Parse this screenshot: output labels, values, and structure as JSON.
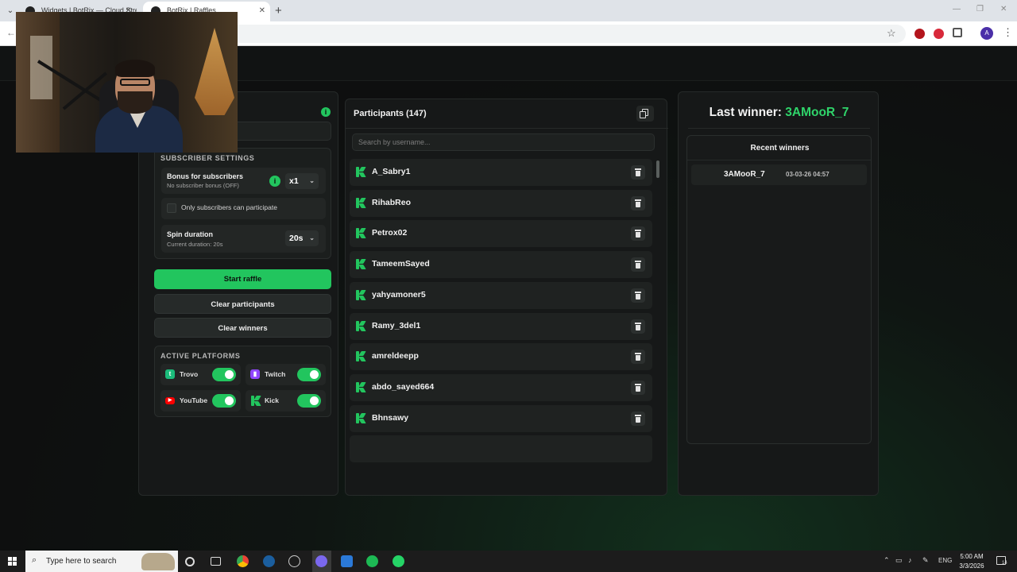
{
  "browser": {
    "tabs": [
      {
        "title": "Widgets | BotRix — Cloud Stre",
        "active": false
      },
      {
        "title": "BotRix | Raffles",
        "active": true
      }
    ],
    "profile_initial": "A"
  },
  "raffle": {
    "subscriber_settings": {
      "title": "SUBSCRIBER SETTINGS",
      "bonus_title": "Bonus for subscribers",
      "bonus_sub": "No subscriber bonus (OFF)",
      "bonus_value": "x1",
      "only_subs_label": "Only subscribers can participate",
      "only_subs_checked": false,
      "spin_title": "Spin duration",
      "spin_sub": "Current duration: 20s",
      "spin_value": "20s"
    },
    "buttons": {
      "start": "Start raffle",
      "clear_participants": "Clear participants",
      "clear_winners": "Clear winners"
    },
    "platforms": {
      "title": "ACTIVE PLATFORMS",
      "items": [
        {
          "name": "Trovo",
          "enabled": true,
          "color": "#1bbc7b"
        },
        {
          "name": "Twitch",
          "enabled": true,
          "color": "#9146ff"
        },
        {
          "name": "YouTube",
          "enabled": true,
          "color": "#ff0000"
        },
        {
          "name": "Kick",
          "enabled": true,
          "color": "#22c55e"
        }
      ]
    }
  },
  "participants": {
    "title": "Participants (147)",
    "search_placeholder": "Search by username...",
    "list": [
      "A_Sabry1",
      "RihabReo",
      "Petrox02",
      "TameemSayed",
      "yahyamoner5",
      "Ramy_3del1",
      "amreldeepp",
      "abdo_sayed664",
      "Bhnsawy"
    ]
  },
  "winners": {
    "last_label": "Last winner:",
    "last_name": "3AMooR_7",
    "recent_title": "Recent winners",
    "recent": [
      {
        "name": "3AMooR_7",
        "time": "03-03-26 04:57"
      }
    ]
  },
  "taskbar": {
    "search_placeholder": "Type here to search",
    "lang": "ENG",
    "time": "5:00 AM",
    "date": "3/3/2026",
    "notifications": "14"
  },
  "colors": {
    "accent": "#22c55e",
    "winner": "#2fd46a",
    "panel": "#161818"
  }
}
